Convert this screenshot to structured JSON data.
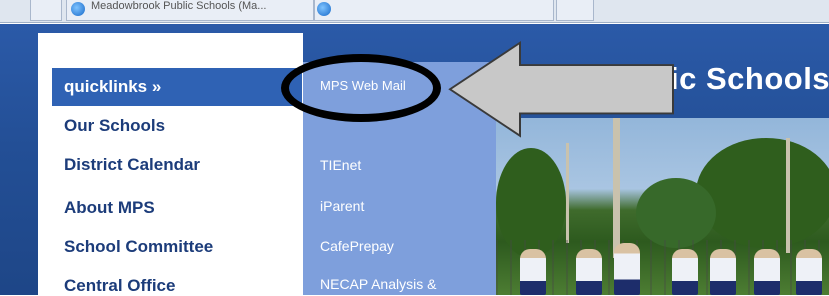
{
  "browser": {
    "tab_title": "Meadowbrook Public Schools (Ma..."
  },
  "header": {
    "title": "Public Schools",
    "title_fragment_visible": "ic Schools"
  },
  "quicklinks": {
    "heading": "quicklinks »",
    "items": [
      {
        "label": "Our Schools"
      },
      {
        "label": "District Calendar"
      },
      {
        "label": "About MPS"
      },
      {
        "label": "School Committee"
      },
      {
        "label": "Central Office"
      }
    ]
  },
  "submenu": {
    "items": [
      {
        "label": "MPS Web Mail"
      },
      {
        "label": "TIEnet"
      },
      {
        "label": "iParent"
      },
      {
        "label": "CafePrepay"
      },
      {
        "label": "NECAP Analysis &"
      }
    ]
  },
  "colors": {
    "header_blue": "#234f96",
    "quicklinks_header": "#2f62b4",
    "submenu_blue": "#7e9fdc",
    "link_text": "#1c3c7a",
    "annotation_arrow": "#c8c8c8"
  },
  "icons": [
    "browser-favicon-icon",
    "annotation-arrow-icon",
    "annotation-ellipse-icon"
  ]
}
